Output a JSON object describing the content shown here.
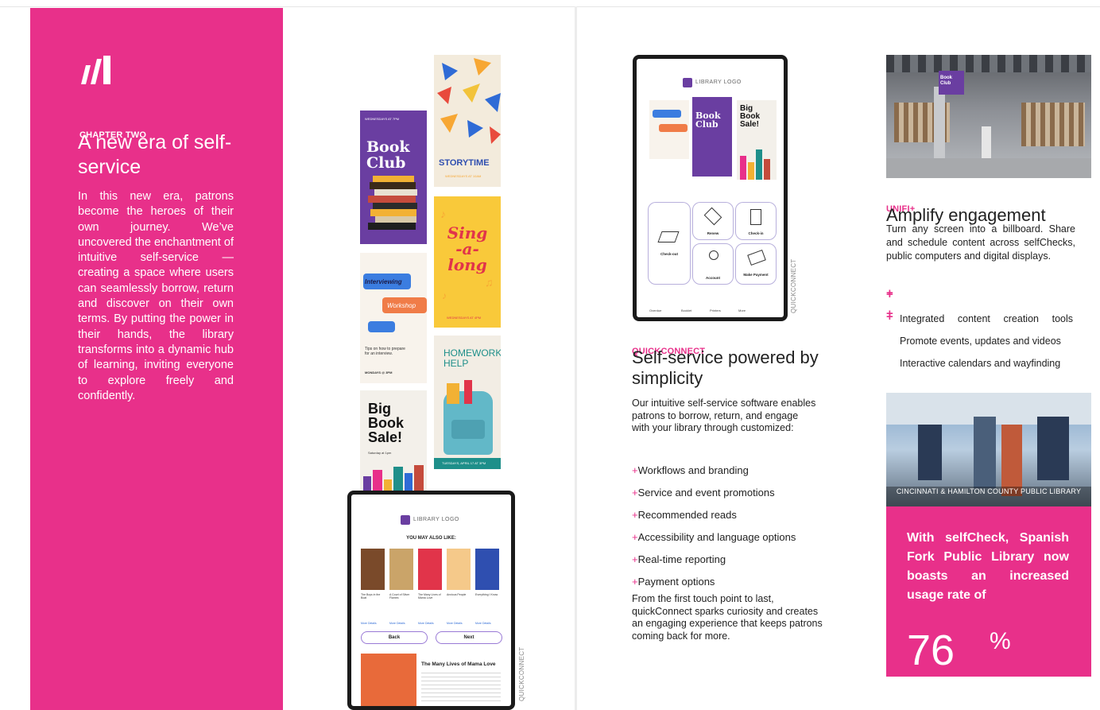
{
  "left_page": {
    "chapter_label": "CHAPTER TWO",
    "title": "A new era of self-service",
    "body": "In this new era, patrons become the heroes of their own journey. We’ve uncovered the enchantment of intuitive self-service — creating a space where users can seamlessly borrow, return and discover on their own terms. By putting the power in their hands, the library transforms into a dynamic hub of learning, inviting everyone to explore freely and confidently.",
    "colors": {
      "accent": "#e8308a"
    }
  },
  "posters": {
    "book_club_date": "WEDNESDAYS AT 7PM",
    "book_club": "Book Club",
    "storytime": "STORYTIME",
    "storytime_sub": "WEDNESDAYS AT 10AM",
    "interviewing": "Interviewing",
    "workshop": "Workshop",
    "interview_tips": "Tips on how to prepare for an interview.",
    "interview_date": "MONDAYS @ 3PM",
    "sing_a_long": "Sing -a- long",
    "sing_date": "WEDNESDAYS AT 4PM",
    "homework_help": "HOMEWORK HELP",
    "homework_date": "TUESDAYS, APRIL 17 AT 3PM",
    "big_book_sale": "Big Book Sale!",
    "sale_date": "Saturday at 1pm"
  },
  "tablet_top": {
    "logo": "LIBRARY LOGO",
    "tiles": [
      "Check-out",
      "Renew",
      "Check-in",
      "Account",
      "Make Payment"
    ],
    "nav": [
      "Overdue",
      "Booklet",
      "Printers",
      "More"
    ],
    "side_label": "QUICKCONNECT"
  },
  "tablet_bottom": {
    "logo": "LIBRARY LOGO",
    "heading": "YOU MAY ALSO LIKE:",
    "books": [
      "The Boys in the Boat",
      "A Court of Silver Flames",
      "The Many Lives of Mama Love",
      "Anxious People",
      "Everything I Know"
    ],
    "more_details": "More Details",
    "back": "Back",
    "next": "Next",
    "feature_title": "The Many Lives of Mama Love",
    "side_label": "QUICKCONNECT"
  },
  "quickconnect": {
    "eyebrow": "QUICKCONNECT",
    "title": "Self-service powered by simplicity",
    "body": "Our intuitive self-service software enables patrons to borrow, return, and engage with your library through customized:",
    "items": [
      "Workflows and branding",
      "Service and event promotions",
      "Recommended reads",
      "Accessibility and language options",
      "Real-time reporting",
      "Payment options"
    ],
    "footer": "From the first touch point to last, quickConnect sparks curiosity and creates an engaging experience that keeps patrons coming back for more."
  },
  "unifi": {
    "eyebrow": "UNIFI+",
    "title": "Amplify engagement",
    "body": "Turn any screen into a billboard. Share and schedule content across selfChecks, public computers and digital displays.",
    "features": [
      "Integrated content creation tools",
      "Promote events, updates and videos",
      "Interactive calendars and wayfinding"
    ],
    "photo_sign": "Book Club"
  },
  "case_study": {
    "caption": "CINCINNATI & HAMILTON COUNTY PUBLIC LIBRARY",
    "statement": "With selfCheck, Spanish Fork Public Library now boasts an increased usage rate of",
    "stat_value": "76",
    "stat_unit": "%"
  }
}
